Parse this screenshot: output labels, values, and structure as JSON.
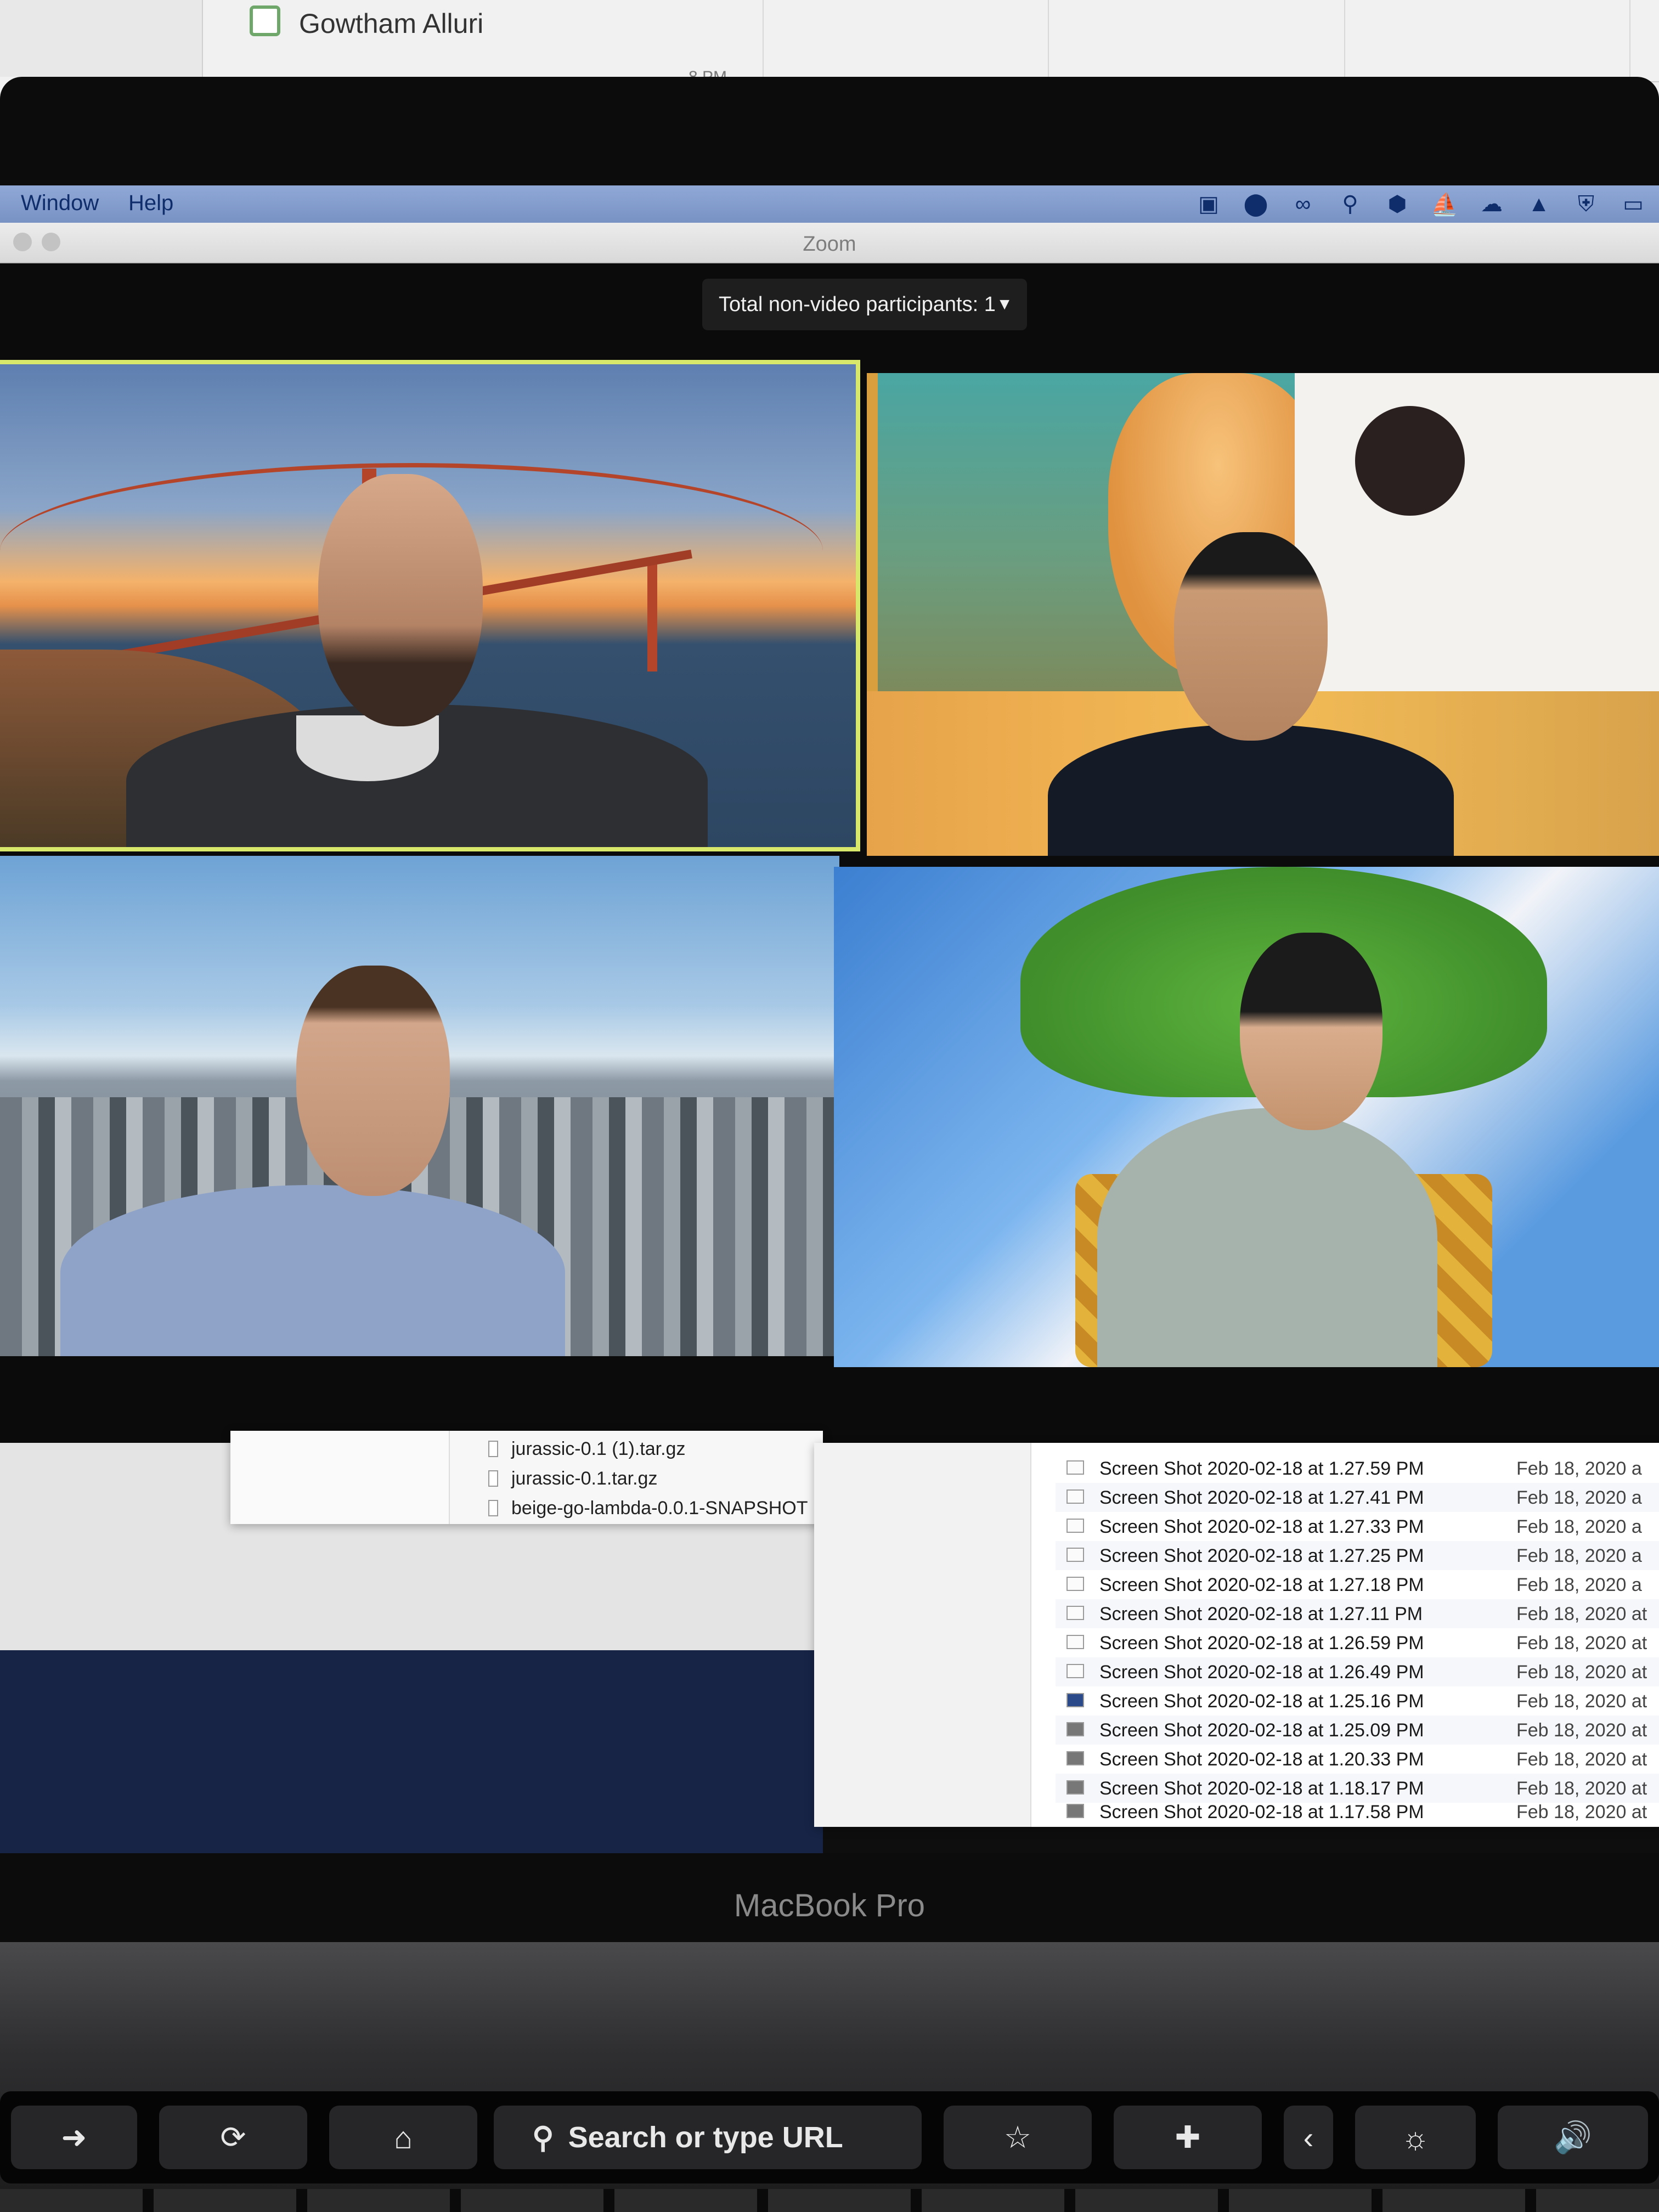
{
  "calendar": {
    "attendee": "Gowtham Alluri",
    "time_label": "8 PM"
  },
  "menubar": {
    "items": [
      "Window",
      "Help"
    ],
    "status_icons": [
      "video-camera-icon",
      "circle-icon",
      "glasses-icon",
      "magnifier-icon",
      "cube-icon",
      "docker-icon",
      "cloud-icon",
      "boat-icon",
      "shield-icon",
      "airplay-icon"
    ]
  },
  "window": {
    "title": "Zoom"
  },
  "zoom": {
    "participants_label": "Total non-video participants: 1",
    "tiles": [
      {
        "background": "Golden Gate Bridge at sunset",
        "active": true
      },
      {
        "background": "fish and dog",
        "active": false
      },
      {
        "background": "New York City skyline",
        "active": false
      },
      {
        "background": "animated game tree",
        "active": false
      }
    ],
    "active_speaker_color": "#d7e86a"
  },
  "downloads_finder": {
    "files": [
      "jurassic-0.1 (1).tar.gz",
      "jurassic-0.1.tar.gz",
      "beige-go-lambda-0.0.1-SNAPSHOT"
    ]
  },
  "screenshots_finder": {
    "rows": [
      {
        "name": "Screen Shot 2020-02-18 at 1.27.59 PM",
        "date": "Feb 18, 2020 a"
      },
      {
        "name": "Screen Shot 2020-02-18 at 1.27.41 PM",
        "date": "Feb 18, 2020 a"
      },
      {
        "name": "Screen Shot 2020-02-18 at 1.27.33 PM",
        "date": "Feb 18, 2020 a"
      },
      {
        "name": "Screen Shot 2020-02-18 at 1.27.25 PM",
        "date": "Feb 18, 2020 a"
      },
      {
        "name": "Screen Shot 2020-02-18 at 1.27.18 PM",
        "date": "Feb 18, 2020 a"
      },
      {
        "name": "Screen Shot 2020-02-18 at 1.27.11 PM",
        "date": "Feb 18, 2020 at"
      },
      {
        "name": "Screen Shot 2020-02-18 at 1.26.59 PM",
        "date": "Feb 18, 2020 at"
      },
      {
        "name": "Screen Shot 2020-02-18 at 1.26.49 PM",
        "date": "Feb 18, 2020 at"
      },
      {
        "name": "Screen Shot 2020-02-18 at 1.25.16 PM",
        "date": "Feb 18, 2020 at"
      },
      {
        "name": "Screen Shot 2020-02-18 at 1.25.09 PM",
        "date": "Feb 18, 2020 at"
      },
      {
        "name": "Screen Shot 2020-02-18 at 1.20.33 PM",
        "date": "Feb 18, 2020 at"
      },
      {
        "name": "Screen Shot 2020-02-18 at 1.18.17 PM",
        "date": "Feb 18, 2020 at"
      },
      {
        "name": "Screen Shot 2020-02-18 at 1.17.58 PM",
        "date": "Feb 18, 2020 at"
      }
    ]
  },
  "laptop": {
    "model_label": "MacBook Pro"
  },
  "touchbar": {
    "search_placeholder": "Search or type URL",
    "keys": [
      "arrow-right-icon",
      "reload-icon",
      "home-icon",
      "search-icon",
      "star-icon",
      "add-icon",
      "brightness-icon",
      "volume-icon"
    ]
  }
}
